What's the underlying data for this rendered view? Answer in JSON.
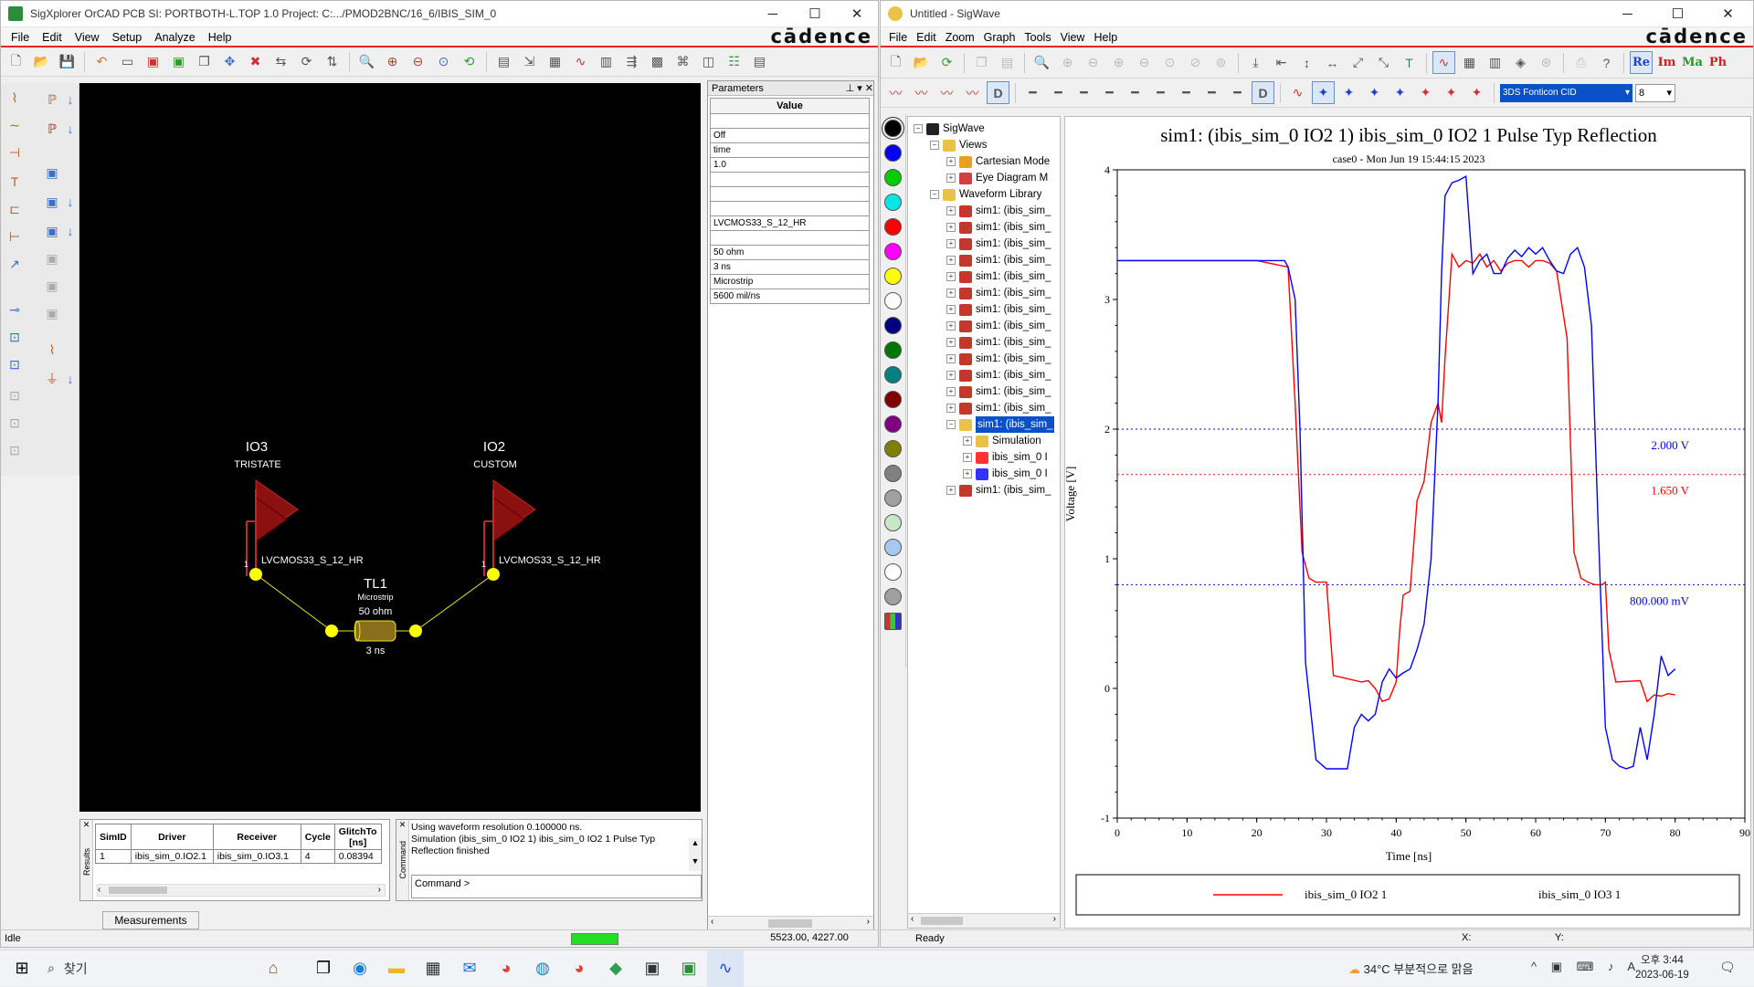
{
  "left": {
    "title": "SigXplorer OrCAD PCB SI: PORTBOTH-L.TOP 1.0  Project: C:.../PMOD2BNC/16_6/IBIS_SIM_0",
    "menu": [
      "File",
      "Edit",
      "View",
      "Setup",
      "Analyze",
      "Help"
    ],
    "logo": "cādence",
    "params": {
      "panel_title": "Parameters",
      "column": "Value",
      "rows": [
        "",
        "Off",
        "time",
        "1.0",
        "",
        "",
        "",
        "LVCMOS33_S_12_HR",
        "",
        "50 ohm",
        "3 ns",
        "Microstrip",
        "5600 mil/ns"
      ]
    },
    "schematic": {
      "io3_name": "IO3",
      "io3_type": "TRISTATE",
      "io3_model": "LVCMOS33_S_12_HR",
      "io3_pin": "1",
      "io2_name": "IO2",
      "io2_type": "CUSTOM",
      "io2_model": "LVCMOS33_S_12_HR",
      "io2_pin": "1",
      "tl_name": "TL1",
      "tl_type": "Microstrip",
      "tl_impedance": "50 ohm",
      "tl_delay": "3 ns"
    },
    "results": {
      "side_label": "Results",
      "columns": [
        "SimID",
        "Driver",
        "Receiver",
        "Cycle",
        "GlitchTo [ns]"
      ],
      "row": [
        "1",
        "ibis_sim_0.IO2.1",
        "ibis_sim_0.IO3.1",
        "4",
        "0.08394"
      ],
      "tab": "Measurements"
    },
    "command": {
      "side_label": "Command",
      "log1": "Using waveform resolution 0.100000 ns.",
      "log2": "Simulation (ibis_sim_0 IO2 1) ibis_sim_0 IO2 1 Pulse Typ",
      "log3": "Reflection finished",
      "prompt": "Command >"
    },
    "status": "Idle",
    "coords": "5523.00, 4227.00"
  },
  "right": {
    "title": "Untitled - SigWave",
    "menu": [
      "File",
      "Edit",
      "Zoom",
      "Graph",
      "Tools",
      "View",
      "Help"
    ],
    "logo": "cādence",
    "complex_buttons": [
      "Re",
      "Im",
      "Ma",
      "Ph"
    ],
    "font_select": "3DS Fonticon CID",
    "font_size": "8",
    "tree": {
      "root": "SigWave",
      "views": "Views",
      "cartesian": "Cartesian Mode",
      "eye": "Eye Diagram M",
      "library": "Waveform Library",
      "sim_item": "sim1: (ibis_sim_",
      "sim_selected": "sim1: (ibis_sim_",
      "simulation": "Simulation",
      "wave_a": "ibis_sim_0 I",
      "wave_b": "ibis_sim_0 I",
      "last": "sim1: (ibis_sim_"
    },
    "status": "Ready",
    "x_label": "X:",
    "y_label": "Y:"
  },
  "chart_data": {
    "type": "line",
    "title": "sim1: (ibis_sim_0 IO2 1) ibis_sim_0 IO2 1 Pulse Typ Reflection",
    "subtitle": "case0 - Mon Jun 19 15:44:15 2023",
    "xlabel": "Time [ns]",
    "ylabel": "Voltage [V]",
    "xlim": [
      0,
      90
    ],
    "ylim": [
      -1,
      4
    ],
    "xticks": [
      0,
      10,
      20,
      30,
      40,
      50,
      60,
      70,
      80,
      90
    ],
    "yticks": [
      -1,
      0,
      1,
      2,
      3,
      4
    ],
    "grid": false,
    "legend_position": "bottom",
    "thresholds": [
      {
        "value": 2.0,
        "label": "2.000 V",
        "color": "#0000ff"
      },
      {
        "value": 1.65,
        "label": "1.650 V",
        "color": "#ff0000"
      },
      {
        "value": 0.8,
        "label": "800.000 mV",
        "color": "#0000ff"
      }
    ],
    "series": [
      {
        "name": "ibis_sim_0 IO2 1",
        "color": "#ff0000",
        "x": [
          0,
          20,
          24.5,
          25.5,
          26.5,
          27.5,
          28.5,
          29.5,
          30,
          31,
          35,
          36,
          37,
          38,
          39,
          40,
          40.5,
          41,
          42,
          43,
          44,
          45,
          46,
          46.5,
          47,
          48,
          49,
          50,
          51,
          52,
          53,
          54,
          55,
          56,
          57,
          58,
          59,
          60,
          61,
          62,
          63,
          64.5,
          65.5,
          66.5,
          67.5,
          68.5,
          69.5,
          70,
          70.5,
          71.5,
          75,
          76,
          77,
          78,
          79,
          80
        ],
        "y": [
          3.3,
          3.3,
          3.25,
          2.2,
          1.05,
          0.85,
          0.82,
          0.82,
          0.82,
          0.1,
          0.05,
          0.06,
          0.0,
          -0.1,
          -0.08,
          0.05,
          0.45,
          0.72,
          0.75,
          1.45,
          1.6,
          2.05,
          2.2,
          2.05,
          2.55,
          3.35,
          3.25,
          3.3,
          3.28,
          3.35,
          3.25,
          3.3,
          3.22,
          3.28,
          3.3,
          3.3,
          3.25,
          3.3,
          3.3,
          3.28,
          3.22,
          2.7,
          1.05,
          0.85,
          0.82,
          0.8,
          0.8,
          0.82,
          0.3,
          0.05,
          0.06,
          -0.1,
          -0.05,
          -0.06,
          -0.04,
          -0.05
        ]
      },
      {
        "name": "ibis_sim_0 IO3 1",
        "color": "#0000ff",
        "x": [
          0,
          24,
          24.5,
          25.5,
          26.2,
          27,
          28.5,
          30,
          31,
          32,
          33,
          34,
          35,
          36,
          37,
          38,
          39,
          40,
          41,
          42,
          43,
          44,
          45,
          46,
          46.5,
          47,
          48,
          49,
          50,
          51,
          52,
          53,
          54,
          55,
          56,
          57,
          58,
          59,
          60,
          61,
          62,
          63,
          64,
          65,
          66,
          67,
          68,
          69,
          70,
          71,
          72,
          73,
          74,
          75,
          76,
          77,
          78,
          79,
          80
        ],
        "y": [
          3.3,
          3.3,
          3.25,
          3.0,
          2.0,
          0.2,
          -0.55,
          -0.62,
          -0.62,
          -0.62,
          -0.62,
          -0.3,
          -0.2,
          -0.25,
          -0.2,
          0.05,
          0.15,
          0.08,
          0.12,
          0.15,
          0.3,
          0.5,
          1.0,
          2.2,
          3.2,
          3.8,
          3.9,
          3.92,
          3.95,
          3.2,
          3.3,
          3.35,
          3.2,
          3.2,
          3.32,
          3.38,
          3.33,
          3.4,
          3.35,
          3.4,
          3.3,
          3.22,
          3.2,
          3.35,
          3.4,
          3.25,
          2.8,
          1.2,
          -0.3,
          -0.55,
          -0.6,
          -0.62,
          -0.6,
          -0.3,
          -0.55,
          -0.2,
          0.25,
          0.1,
          0.15
        ]
      }
    ]
  }
}
